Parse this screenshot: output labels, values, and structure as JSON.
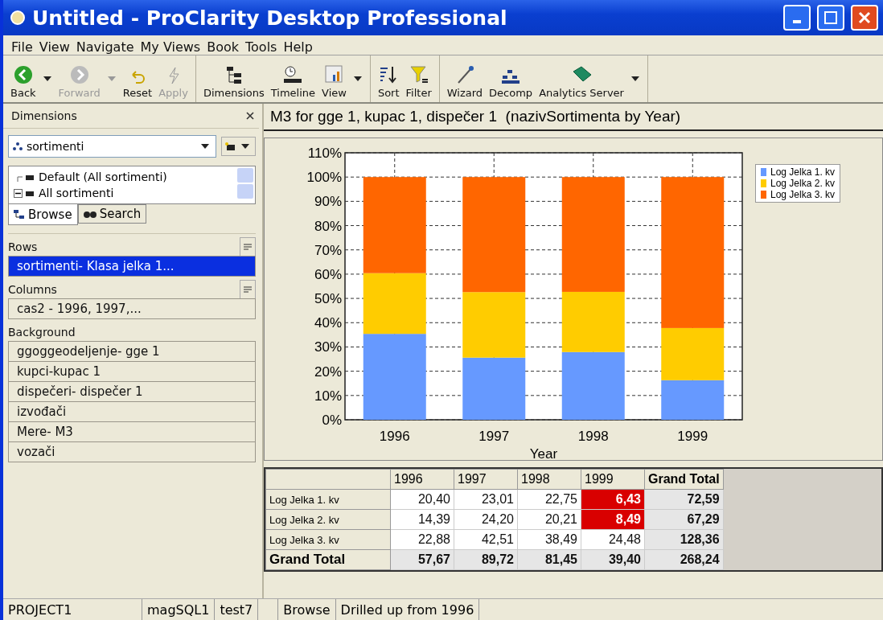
{
  "window": {
    "title": "Untitled - ProClarity Desktop Professional"
  },
  "menu": [
    "File",
    "View",
    "Navigate",
    "My Views",
    "Book",
    "Tools",
    "Help"
  ],
  "toolbar": [
    [
      {
        "label": "Back",
        "disabled": false,
        "dropdown": true
      },
      {
        "label": "Forward",
        "disabled": true,
        "dropdown": true
      },
      {
        "label": "Reset",
        "disabled": false,
        "dropdown": false
      },
      {
        "label": "Apply",
        "disabled": true,
        "dropdown": false
      }
    ],
    [
      {
        "label": "Dimensions",
        "disabled": false,
        "dropdown": false
      },
      {
        "label": "Timeline",
        "disabled": false,
        "dropdown": false
      },
      {
        "label": "View",
        "disabled": false,
        "dropdown": true
      }
    ],
    [
      {
        "label": "Sort",
        "disabled": false,
        "dropdown": false
      },
      {
        "label": "Filter",
        "disabled": false,
        "dropdown": false
      }
    ],
    [
      {
        "label": "Wizard",
        "disabled": false,
        "dropdown": false
      },
      {
        "label": "Decomp",
        "disabled": false,
        "dropdown": false
      },
      {
        "label": "Analytics Server",
        "disabled": false,
        "dropdown": true
      }
    ]
  ],
  "sidebar": {
    "title": "Dimensions",
    "dimension_select": {
      "value": "sortimenti"
    },
    "tree": [
      {
        "kind": "leaf",
        "label": "Default (All sortimenti)"
      },
      {
        "kind": "node",
        "label": "All sortimenti",
        "expanded": true
      }
    ],
    "tabs": [
      {
        "label": "Browse",
        "selected": true
      },
      {
        "label": "Search",
        "selected": false
      }
    ],
    "sections": [
      {
        "title": "Rows",
        "items": [
          {
            "label": "sortimenti- Klasa jelka 1...",
            "selected": true
          }
        ]
      },
      {
        "title": "Columns",
        "items": [
          {
            "label": "cas2 - 1996, 1997,...",
            "selected": false
          }
        ]
      },
      {
        "title": "Background",
        "items": [
          {
            "label": "ggoggeodeljenje- gge 1",
            "selected": false
          },
          {
            "label": "kupci-kupac 1",
            "selected": false
          },
          {
            "label": "dispečeri- dispečer 1",
            "selected": false
          },
          {
            "label": "izvođači",
            "selected": false
          },
          {
            "label": "Mere- M3",
            "selected": false
          },
          {
            "label": "vozači",
            "selected": false
          }
        ]
      }
    ]
  },
  "view_title": "M3 for gge 1, kupac 1, dispečer 1  (nazivSortimenta by Year)",
  "chart_data": {
    "type": "bar",
    "stacked": true,
    "grid": true,
    "xlabel": "Year",
    "categories": [
      "1996",
      "1997",
      "1998",
      "1999"
    ],
    "ylim": [
      0,
      110
    ],
    "yticks": [
      {
        "value": 0,
        "label": "0%"
      },
      {
        "value": 10,
        "label": "10%"
      },
      {
        "value": 20,
        "label": "20%"
      },
      {
        "value": 30,
        "label": "30%"
      },
      {
        "value": 40,
        "label": "40%"
      },
      {
        "value": 50,
        "label": "50%"
      },
      {
        "value": 60,
        "label": "60%"
      },
      {
        "value": 70,
        "label": "70%"
      },
      {
        "value": 80,
        "label": "80%"
      },
      {
        "value": 90,
        "label": "90%"
      },
      {
        "value": 100,
        "label": "100%"
      },
      {
        "value": 110,
        "label": "110%"
      }
    ],
    "series": [
      {
        "name": "Log Jelka 1. kv",
        "color": "#6699ff",
        "values": [
          35.4,
          25.6,
          27.9,
          16.3
        ]
      },
      {
        "name": "Log Jelka 2. kv",
        "color": "#ffcc00",
        "values": [
          25.0,
          27.0,
          24.8,
          21.5
        ]
      },
      {
        "name": "Log Jelka 3. kv",
        "color": "#ff6600",
        "values": [
          39.6,
          47.4,
          47.3,
          62.2
        ]
      }
    ]
  },
  "table": {
    "columns": [
      "1996",
      "1997",
      "1998",
      "1999",
      "Grand Total"
    ],
    "rows": [
      {
        "kind": "data",
        "label": "Log Jelka 1. kv",
        "cells": [
          {
            "text": "20,40",
            "alert": false
          },
          {
            "text": "23,01",
            "alert": false
          },
          {
            "text": "22,75",
            "alert": false
          },
          {
            "text": "6,43",
            "alert": true
          },
          {
            "text": "72,59",
            "alert": false
          }
        ]
      },
      {
        "kind": "data",
        "label": "Log Jelka 2. kv",
        "cells": [
          {
            "text": "14,39",
            "alert": false
          },
          {
            "text": "24,20",
            "alert": false
          },
          {
            "text": "20,21",
            "alert": false
          },
          {
            "text": "8,49",
            "alert": true
          },
          {
            "text": "67,29",
            "alert": false
          }
        ]
      },
      {
        "kind": "data",
        "label": "Log Jelka 3. kv",
        "cells": [
          {
            "text": "22,88",
            "alert": false
          },
          {
            "text": "42,51",
            "alert": false
          },
          {
            "text": "38,49",
            "alert": false
          },
          {
            "text": "24,48",
            "alert": false
          },
          {
            "text": "128,36",
            "alert": false
          }
        ]
      },
      {
        "kind": "total",
        "label": "Grand Total",
        "cells": [
          {
            "text": "57,67",
            "alert": false
          },
          {
            "text": "89,72",
            "alert": false
          },
          {
            "text": "81,45",
            "alert": false
          },
          {
            "text": "39,40",
            "alert": false
          },
          {
            "text": "268,24",
            "alert": false
          }
        ]
      }
    ]
  },
  "status_bar": [
    "PROJECT1",
    "magSQL1",
    "test7",
    "Browse",
    "Drilled up from 1996"
  ]
}
